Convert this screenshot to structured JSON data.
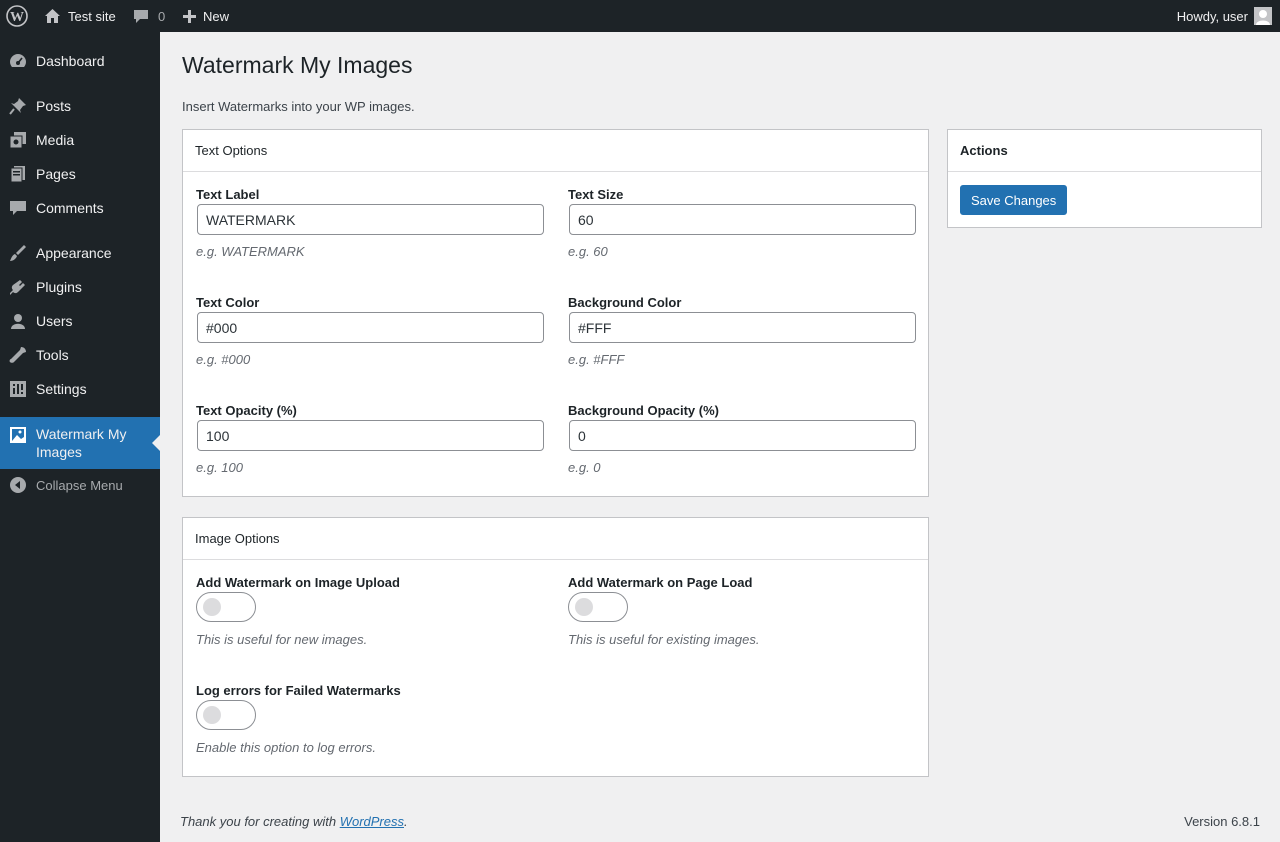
{
  "admin_bar": {
    "site_name": "Test site",
    "comments_count": "0",
    "new_label": "New",
    "howdy": "Howdy, user"
  },
  "sidebar": {
    "items": [
      {
        "label": "Dashboard",
        "icon": "dashboard-icon"
      },
      {
        "label": "Posts",
        "icon": "pin-icon"
      },
      {
        "label": "Media",
        "icon": "media-icon"
      },
      {
        "label": "Pages",
        "icon": "pages-icon"
      },
      {
        "label": "Comments",
        "icon": "comments-icon"
      },
      {
        "label": "Appearance",
        "icon": "brush-icon"
      },
      {
        "label": "Plugins",
        "icon": "plugin-icon"
      },
      {
        "label": "Users",
        "icon": "users-icon"
      },
      {
        "label": "Tools",
        "icon": "wrench-icon"
      },
      {
        "label": "Settings",
        "icon": "settings-icon"
      },
      {
        "label": "Watermark My Images",
        "icon": "image-icon"
      }
    ],
    "collapse_label": "Collapse Menu"
  },
  "page": {
    "title": "Watermark My Images",
    "description": "Insert Watermarks into your WP images."
  },
  "text_options": {
    "heading": "Text Options",
    "fields": [
      {
        "label": "Text Label",
        "value": "WATERMARK",
        "hint": "e.g. WATERMARK"
      },
      {
        "label": "Text Size",
        "value": "60",
        "hint": "e.g. 60"
      },
      {
        "label": "Text Color",
        "value": "#000",
        "hint": "e.g. #000"
      },
      {
        "label": "Background Color",
        "value": "#FFF",
        "hint": "e.g. #FFF"
      },
      {
        "label": "Text Opacity (%)",
        "value": "100",
        "hint": "e.g. 100"
      },
      {
        "label": "Background Opacity (%)",
        "value": "0",
        "hint": "e.g. 0"
      }
    ]
  },
  "image_options": {
    "heading": "Image Options",
    "toggles": [
      {
        "label": "Add Watermark on Image Upload",
        "hint": "This is useful for new images.",
        "checked": false
      },
      {
        "label": "Add Watermark on Page Load",
        "hint": "This is useful for existing images.",
        "checked": false
      },
      {
        "label": "Log errors for Failed Watermarks",
        "hint": "Enable this option to log errors.",
        "checked": false
      }
    ]
  },
  "actions": {
    "heading": "Actions",
    "save_label": "Save Changes"
  },
  "footer": {
    "thanks_prefix": "Thank you for creating with ",
    "link_text": "WordPress",
    "thanks_suffix": ".",
    "version": "Version 6.8.1"
  },
  "colors": {
    "admin_dark": "#1d2327",
    "accent": "#2271b1",
    "background": "#f0f0f1"
  }
}
